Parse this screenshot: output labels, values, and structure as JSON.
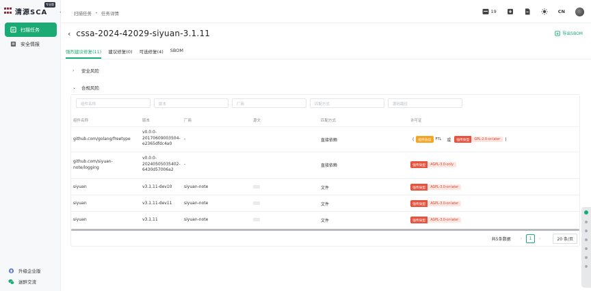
{
  "app": {
    "logo_text": "清源SCA",
    "logo_badge": "专业版"
  },
  "sidebar": {
    "items": [
      {
        "label": "扫描任务",
        "active": true
      },
      {
        "label": "安全情报",
        "active": false
      }
    ],
    "bottom": [
      {
        "label": "升级企业版"
      },
      {
        "label": "迷醉交流"
      }
    ]
  },
  "header": {
    "breadcrumb": [
      "扫描任务",
      "任务详情"
    ],
    "notification_count": "19",
    "lang": "CN"
  },
  "page": {
    "title": "cssa-2024-42029-siyuan-3.1.11",
    "export_label": "导出SBOM",
    "tabs": [
      {
        "label": "强烈建议修复(11)",
        "active": true
      },
      {
        "label": "建议修复(0)",
        "active": false
      },
      {
        "label": "可选修复(4)",
        "active": false
      },
      {
        "label": "SBOM",
        "active": false
      }
    ],
    "sections": {
      "security": "安全风险",
      "compliance": "合规风险"
    }
  },
  "table": {
    "filters": [
      "组件名称",
      "版本",
      "厂商",
      "匹配方式",
      "源码路径"
    ],
    "headers": {
      "name": "组件名称",
      "version": "版本",
      "vendor": "厂商",
      "source": "源文",
      "match": "匹配方式",
      "license": "许可证"
    },
    "rows": [
      {
        "name": "github.com/golang/freetype",
        "version": [
          "v0.0.0-",
          "20170609003504-",
          "e2365dfdc4a0"
        ],
        "vendor": "-",
        "match": "直接依赖",
        "license_type": "compound",
        "tag1": "组件协议",
        "lic1": "FTL",
        "or": "或",
        "tag2": "强传染型",
        "lic2": "GPL-2.0-or-later",
        "open_paren": "(",
        "close_paren": ")"
      },
      {
        "name": [
          "github.com/siyuan-",
          "note/logging"
        ],
        "version": [
          "v0.0.0-",
          "20240505035402-",
          "6430d57006a2"
        ],
        "vendor": "-",
        "match": "直接依赖",
        "tag": "强传染型",
        "lic": "AGPL-3.0-only"
      },
      {
        "name": "siyuan",
        "version": "v3.1.11-dev10",
        "vendor": "siyuan-note",
        "match": "文件",
        "tag": "强传染型",
        "lic": "AGPL-3.0-or-later"
      },
      {
        "name": "siyuan",
        "version": "v3.1.11-dev11",
        "vendor": "siyuan-note",
        "match": "文件",
        "tag": "强传染型",
        "lic": "AGPL-3.0-or-later"
      },
      {
        "name": "siyuan",
        "version": "v3.1.11",
        "vendor": "siyuan-note",
        "match": "文件",
        "tag": "强传染型",
        "lic": "AGPL-3.0-or-later"
      }
    ]
  },
  "pagination": {
    "total": "共5条数据",
    "prev": "‹",
    "current": "1",
    "next": "›",
    "page_size": "20 条/页"
  },
  "colors": {
    "accent": "#1aaa73",
    "danger": "#e8533d",
    "warning": "#f5a524"
  }
}
